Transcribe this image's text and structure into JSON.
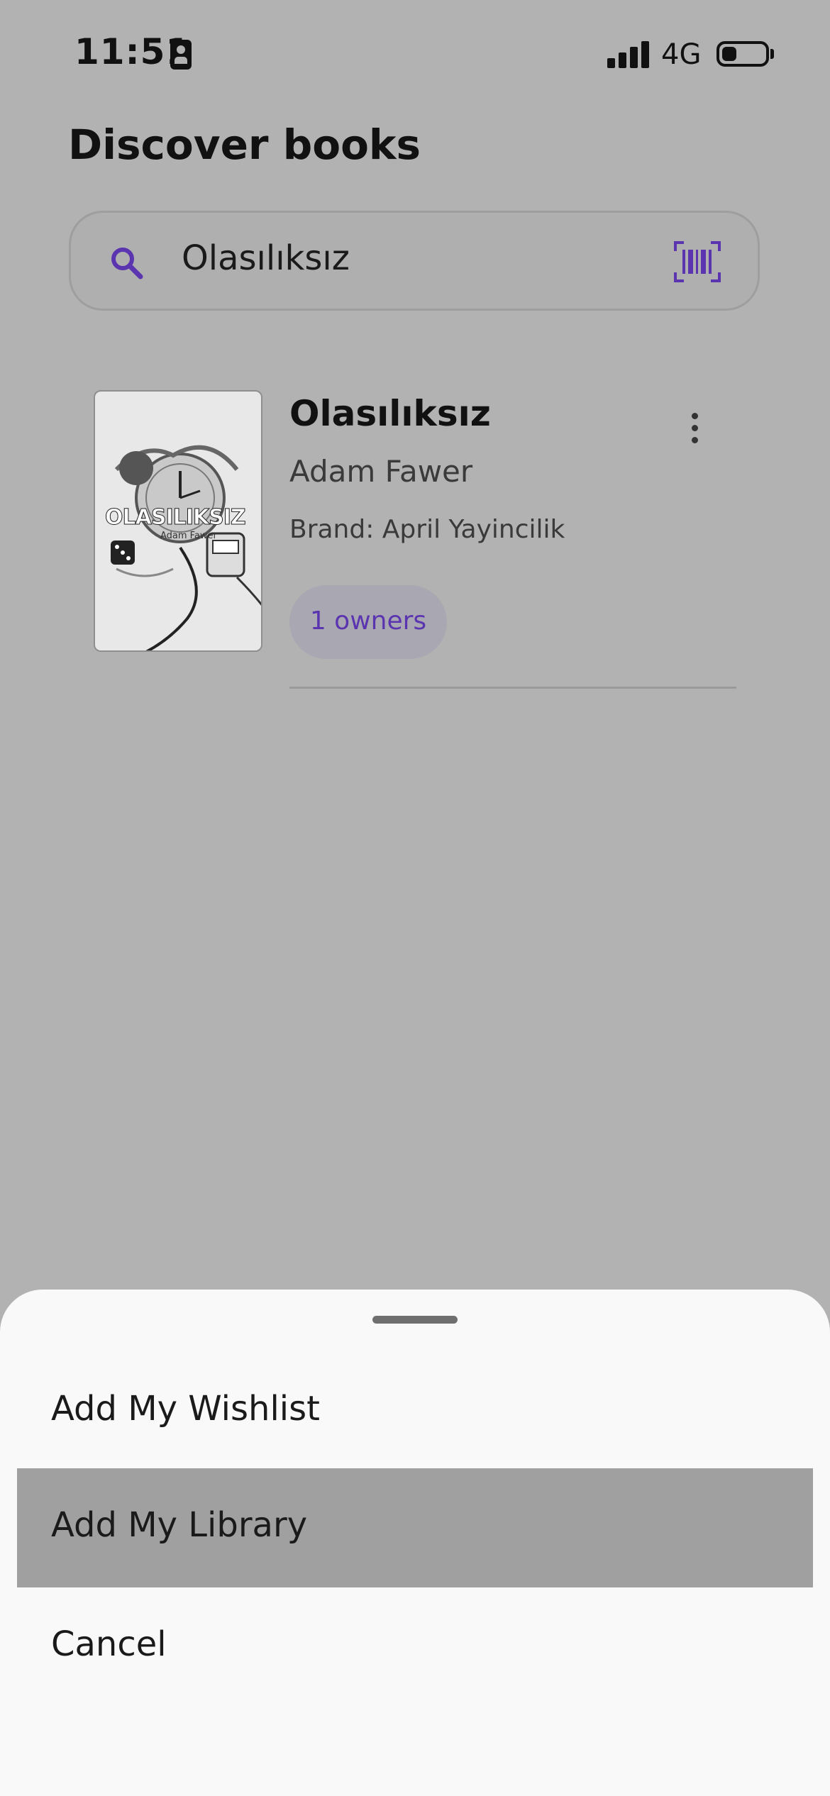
{
  "status_bar": {
    "time": "11:51",
    "network": "4G"
  },
  "page_title": "Discover books",
  "search": {
    "value": "Olasılıksız"
  },
  "book": {
    "title": "Olasılıksız",
    "author": "Adam Fawer",
    "brand": "Brand: April Yayincilik",
    "owners": "1 owners",
    "cover_title": "OLASILIKSIZ",
    "cover_author": "Adam Fawer"
  },
  "sheet": {
    "items": [
      {
        "label": "Add My Wishlist"
      },
      {
        "label": "Add My Library"
      },
      {
        "label": "Cancel"
      }
    ]
  },
  "colors": {
    "accent": "#5b35b0",
    "overlay": "#b2b2b2",
    "sheet": "#f9f9f9",
    "highlight": "#a0a0a0"
  }
}
